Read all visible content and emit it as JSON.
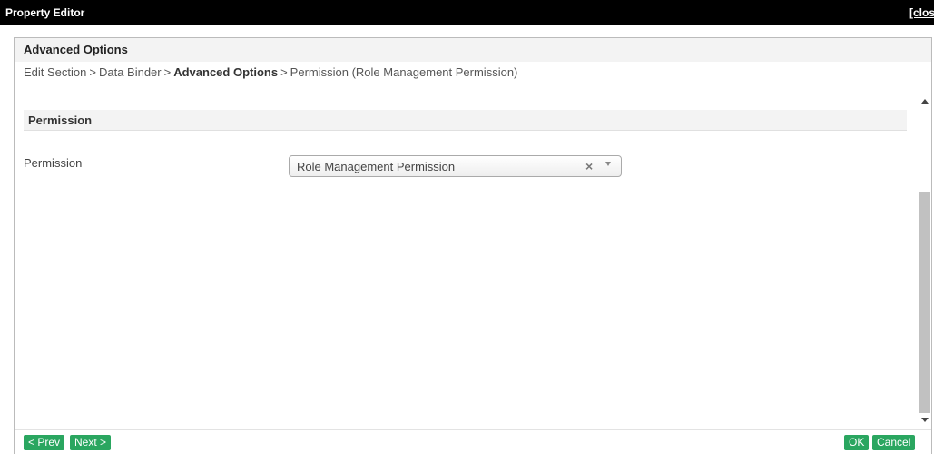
{
  "window": {
    "title": "Property Editor",
    "close_label": "[close]"
  },
  "panel": {
    "title": "Advanced Options"
  },
  "breadcrumb": {
    "items": [
      "Edit Section",
      "Data Binder",
      "Advanced Options",
      "Permission (Role Management Permission)"
    ],
    "separator": ">"
  },
  "section": {
    "title": "Permission"
  },
  "field": {
    "label": "Permission",
    "value": "Role Management Permission",
    "clear_symbol": "×"
  },
  "footer": {
    "prev_label": "< Prev",
    "next_label": "Next >",
    "ok_label": "OK",
    "cancel_label": "Cancel"
  },
  "colors": {
    "titlebar_bg": "#000000",
    "button_green": "#2aa660",
    "header_bg": "#f3f3f3"
  }
}
